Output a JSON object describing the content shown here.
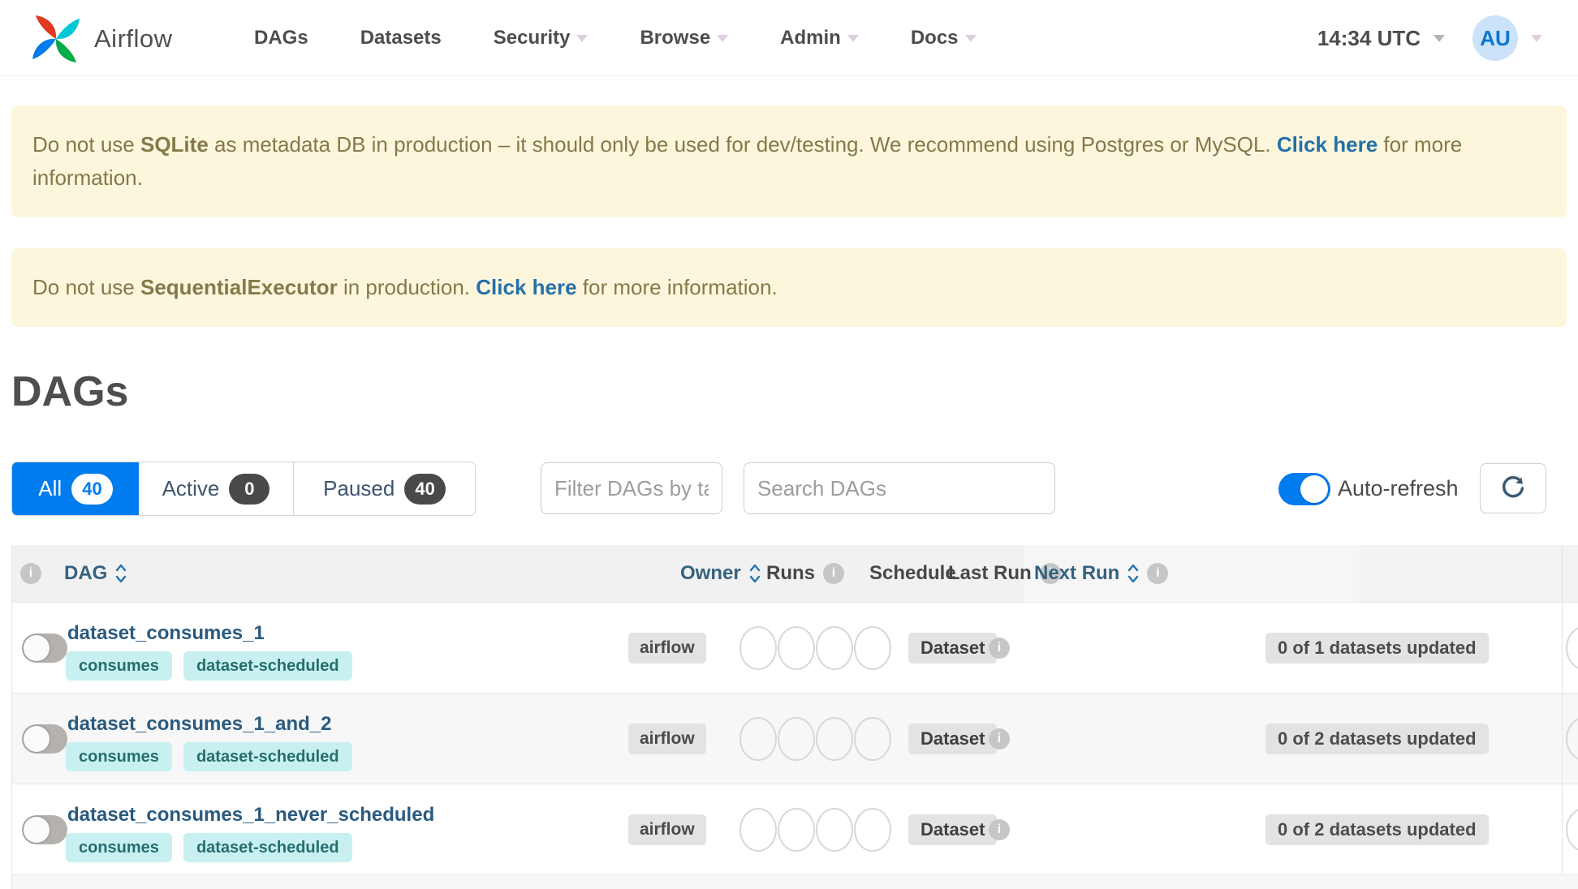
{
  "colors": {
    "accent_blue": "#017cee",
    "warning_bg": "#fcf6dd",
    "warning_text": "#85794a",
    "link_blue": "#2570a9",
    "tag_bg": "#c9f0f1",
    "tag_text": "#256e6e",
    "sortable_header_blue": "#35617f",
    "badge_gray_bg": "#e3e3e3"
  },
  "navbar": {
    "brand": "Airflow",
    "items": [
      {
        "label": "DAGs"
      },
      {
        "label": "Datasets"
      },
      {
        "label": "Security"
      },
      {
        "label": "Browse"
      },
      {
        "label": "Admin"
      },
      {
        "label": "Docs"
      }
    ],
    "clock": "14:34 UTC",
    "avatar_initials": "AU"
  },
  "alerts": [
    {
      "prefix": "Do not use ",
      "emphasis": "SQLite",
      "middle": " as metadata DB in production – it should only be used for dev/testing. We recommend using Postgres or MySQL. ",
      "link": "Click here",
      "suffix": " for more information."
    },
    {
      "prefix": "Do not use ",
      "emphasis": "SequentialExecutor",
      "middle": " in production. ",
      "link": "Click here",
      "suffix": " for more information."
    }
  ],
  "page_title": "DAGs",
  "controls": {
    "tabs": [
      {
        "label": "All",
        "count": "40"
      },
      {
        "label": "Active",
        "count": "0"
      },
      {
        "label": "Paused",
        "count": "40"
      }
    ],
    "tag_filter_placeholder": "Filter DAGs by tag",
    "search_placeholder": "Search DAGs",
    "auto_refresh_label": "Auto-refresh"
  },
  "table": {
    "headers": {
      "dag": "DAG",
      "owner": "Owner",
      "runs": "Runs",
      "schedule": "Schedule",
      "last_run": "Last Run",
      "next_run": "Next Run"
    },
    "rows": [
      {
        "name": "dataset_consumes_1",
        "tags": [
          "consumes",
          "dataset-scheduled"
        ],
        "owner": "airflow",
        "schedule": "Dataset",
        "next_run": "0 of 1 datasets updated"
      },
      {
        "name": "dataset_consumes_1_and_2",
        "tags": [
          "consumes",
          "dataset-scheduled"
        ],
        "owner": "airflow",
        "schedule": "Dataset",
        "next_run": "0 of 2 datasets updated"
      },
      {
        "name": "dataset_consumes_1_never_scheduled",
        "tags": [
          "consumes",
          "dataset-scheduled"
        ],
        "owner": "airflow",
        "schedule": "Dataset",
        "next_run": "0 of 2 datasets updated"
      }
    ]
  }
}
